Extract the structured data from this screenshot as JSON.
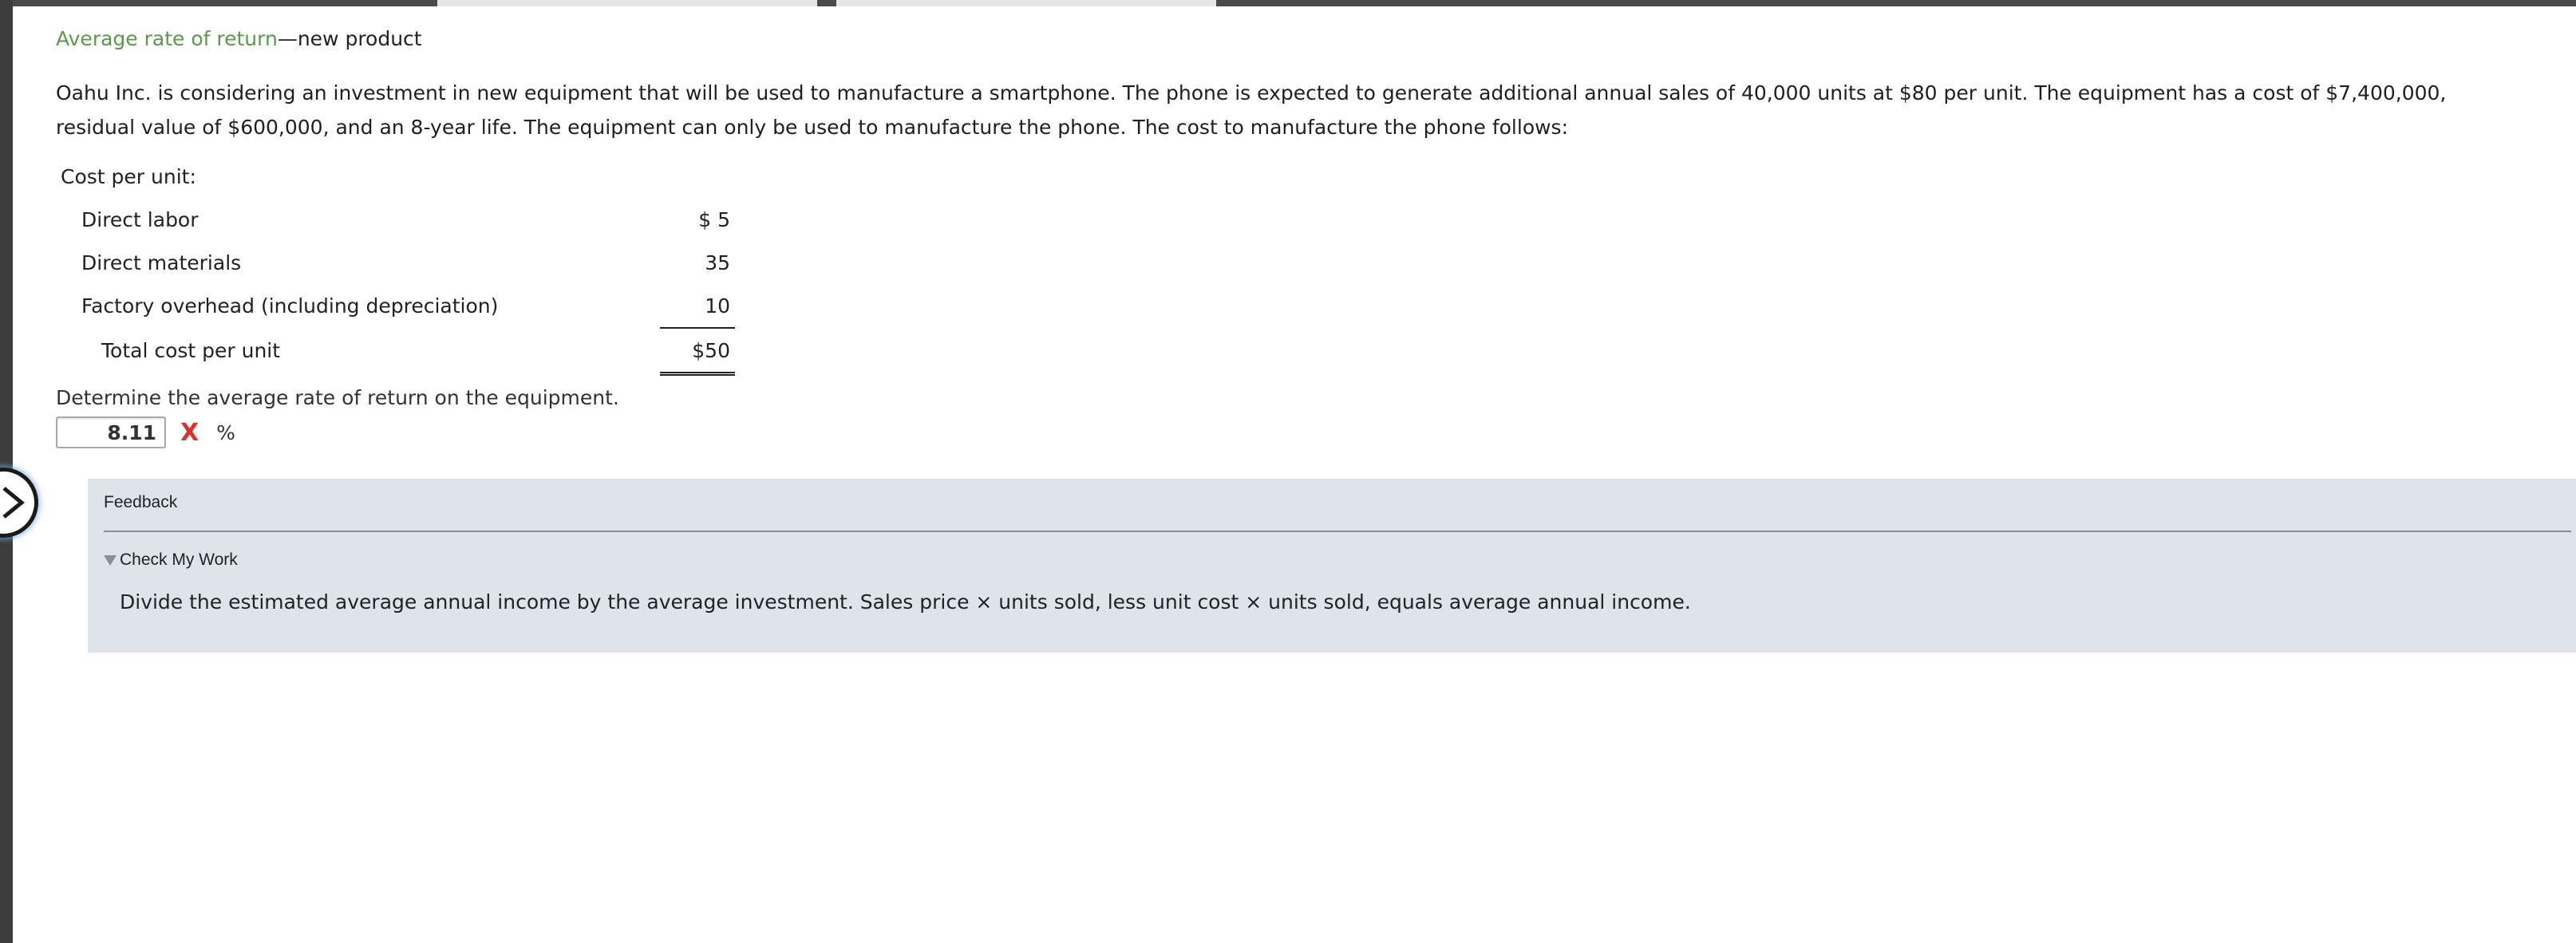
{
  "header": {
    "title_accent": "Average rate of return",
    "title_rest": "—new product"
  },
  "problem": {
    "text": "Oahu Inc. is considering an investment in new equipment that will be used to manufacture a smartphone. The phone is expected to generate additional annual sales of 40,000 units at $80 per unit. The equipment has a cost of $7,400,000, residual value of $600,000, and an 8-year life. The equipment can only be used to manufacture the phone. The cost to manufacture the phone follows:"
  },
  "cost_table": {
    "heading": "Cost per unit:",
    "rows": [
      {
        "label": "Direct labor",
        "value": "$ 5"
      },
      {
        "label": "Direct materials",
        "value": "35"
      },
      {
        "label": "Factory overhead (including depreciation)",
        "value": "10"
      }
    ],
    "total": {
      "label": "Total cost per unit",
      "value": "$50"
    }
  },
  "question": {
    "prompt": "Determine the average rate of return on the equipment.",
    "answer_value": "8.11",
    "status_mark": "X",
    "unit": "%"
  },
  "feedback": {
    "title": "Feedback",
    "section_label": "Check My Work",
    "hint": "Divide the estimated average annual income by the average investment. Sales price × units sold, less unit cost × units sold, equals average annual income."
  },
  "icons": {
    "nav": "chevron-right-icon",
    "wrong": "x-mark-icon",
    "collapse": "triangle-down-icon"
  },
  "colors": {
    "accent_green": "#5a9a4a",
    "wrong_red": "#d9342b",
    "feedback_bg": "#dde5ea"
  }
}
